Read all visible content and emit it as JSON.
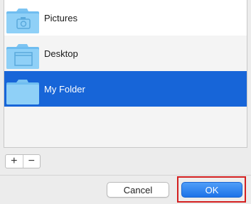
{
  "folders": [
    {
      "label": "Pictures",
      "icon": "pictures-folder-icon",
      "selected": false
    },
    {
      "label": "Desktop",
      "icon": "desktop-folder-icon",
      "selected": false
    },
    {
      "label": "My Folder",
      "icon": "folder-icon",
      "selected": true
    }
  ],
  "toolbar": {
    "add_label": "+",
    "remove_label": "−"
  },
  "buttons": {
    "cancel_label": "Cancel",
    "ok_label": "OK"
  },
  "colors": {
    "selection": "#1765d8",
    "folder": "#5ab3ee",
    "highlight": "#d42020"
  }
}
